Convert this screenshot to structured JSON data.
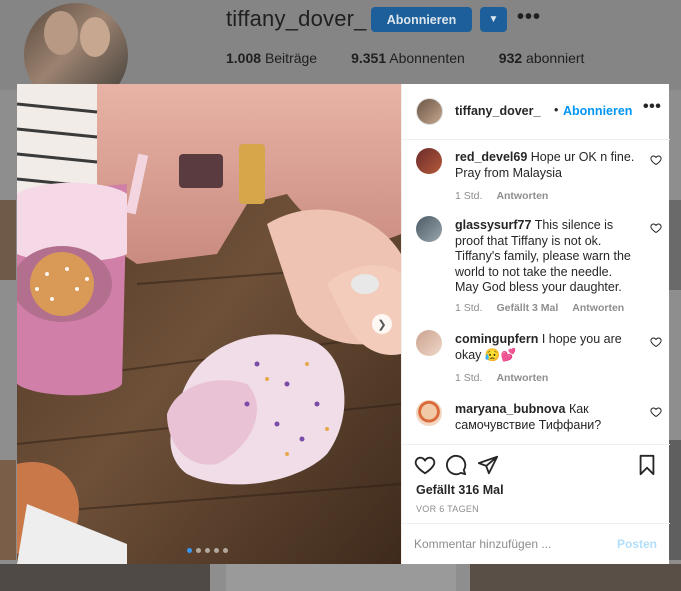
{
  "profile": {
    "username": "tiffany_dover_",
    "follow_label": "Abonnieren",
    "more": "•••",
    "stats": [
      {
        "value": "1.008",
        "label": "Beiträge"
      },
      {
        "value": "9.351",
        "label": "Abonnenten"
      },
      {
        "value": "932",
        "label": "abonniert"
      }
    ]
  },
  "post": {
    "username": "tiffany_dover_",
    "dot": "•",
    "follow_label": "Abonnieren",
    "more": "•••",
    "comments": [
      {
        "user": "red_devel69",
        "text": "Hope ur OK n fine. Pray from Malaysia",
        "time": "1 Std.",
        "likes": "",
        "reply": "Antworten"
      },
      {
        "user": "glassysurf77",
        "text": "This silence is proof that Tiffany is not ok. Tiffany's family, please warn the world to not take the needle. May God bless your daughter.",
        "time": "1 Std.",
        "likes": "Gefällt 3 Mal",
        "reply": "Antworten"
      },
      {
        "user": "comingupfern",
        "text": "I hope you are okay 😥💕",
        "time": "1 Std.",
        "likes": "",
        "reply": "Antworten"
      },
      {
        "user": "maryana_bubnova",
        "text": "Как самочувствие Тиффани?",
        "time": "",
        "likes": "",
        "reply": ""
      }
    ],
    "likes_text": "Gefällt 316 Mal",
    "ago_text": "VOR 6 TAGEN",
    "comment_placeholder": "Kommentar hinzufügen ...",
    "post_label": "Posten",
    "icons": [
      "heart-icon",
      "comment-icon",
      "share-icon",
      "bookmark-icon"
    ],
    "accent_color": "#0095f6",
    "carousel": {
      "slides": 5,
      "current": 1
    }
  }
}
